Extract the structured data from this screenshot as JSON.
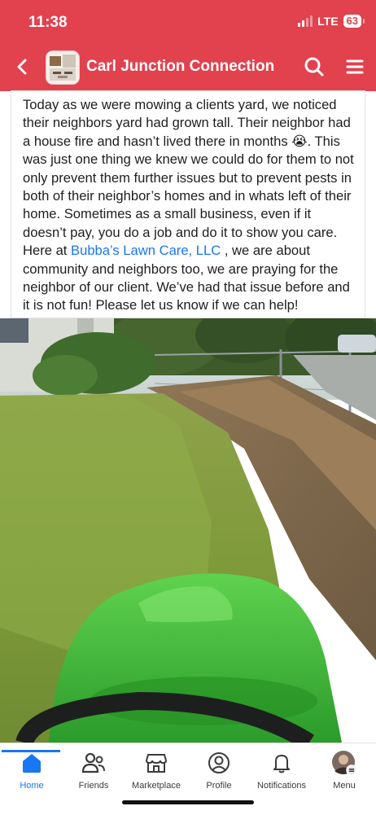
{
  "status_bar": {
    "time": "11:38",
    "network": "LTE",
    "battery": "63"
  },
  "header": {
    "title": "Carl Junction Connection",
    "back_icon": "chevron-left-icon",
    "search_icon": "search-icon",
    "menu_icon": "hamburger-icon",
    "bg_color": "#e2414e"
  },
  "post": {
    "text_part1": "Today as we were mowing a clients yard, we noticed their neighbors yard had grown tall. Their neighbor had a house fire and hasn’t lived there in months 😭. This was just one thing we knew we could do for them to not only prevent them further issues but to prevent pests in both of their neighbor’s homes and in whats left of their home. Sometimes as a small business, even if it doesn’t pay, you do a job and do it to show you care. Here at ",
    "page_link": "Bubba’s Lawn Care, LLC",
    "text_part2": " , we are about community and neighbors too, we are praying for the neighbor of our client. We’ve had that issue before and it is not fun! Please let us know if we can help!",
    "link_color": "#1877f2"
  },
  "bottom_nav": {
    "items": [
      {
        "label": "Home",
        "icon": "home-icon",
        "active": true
      },
      {
        "label": "Friends",
        "icon": "friends-icon",
        "active": false
      },
      {
        "label": "Marketplace",
        "icon": "marketplace-icon",
        "active": false
      },
      {
        "label": "Profile",
        "icon": "profile-icon",
        "active": false
      },
      {
        "label": "Notifications",
        "icon": "bell-icon",
        "active": false
      },
      {
        "label": "Menu",
        "icon": "avatar-menu-icon",
        "active": false
      }
    ],
    "active_color": "#1877f2"
  }
}
